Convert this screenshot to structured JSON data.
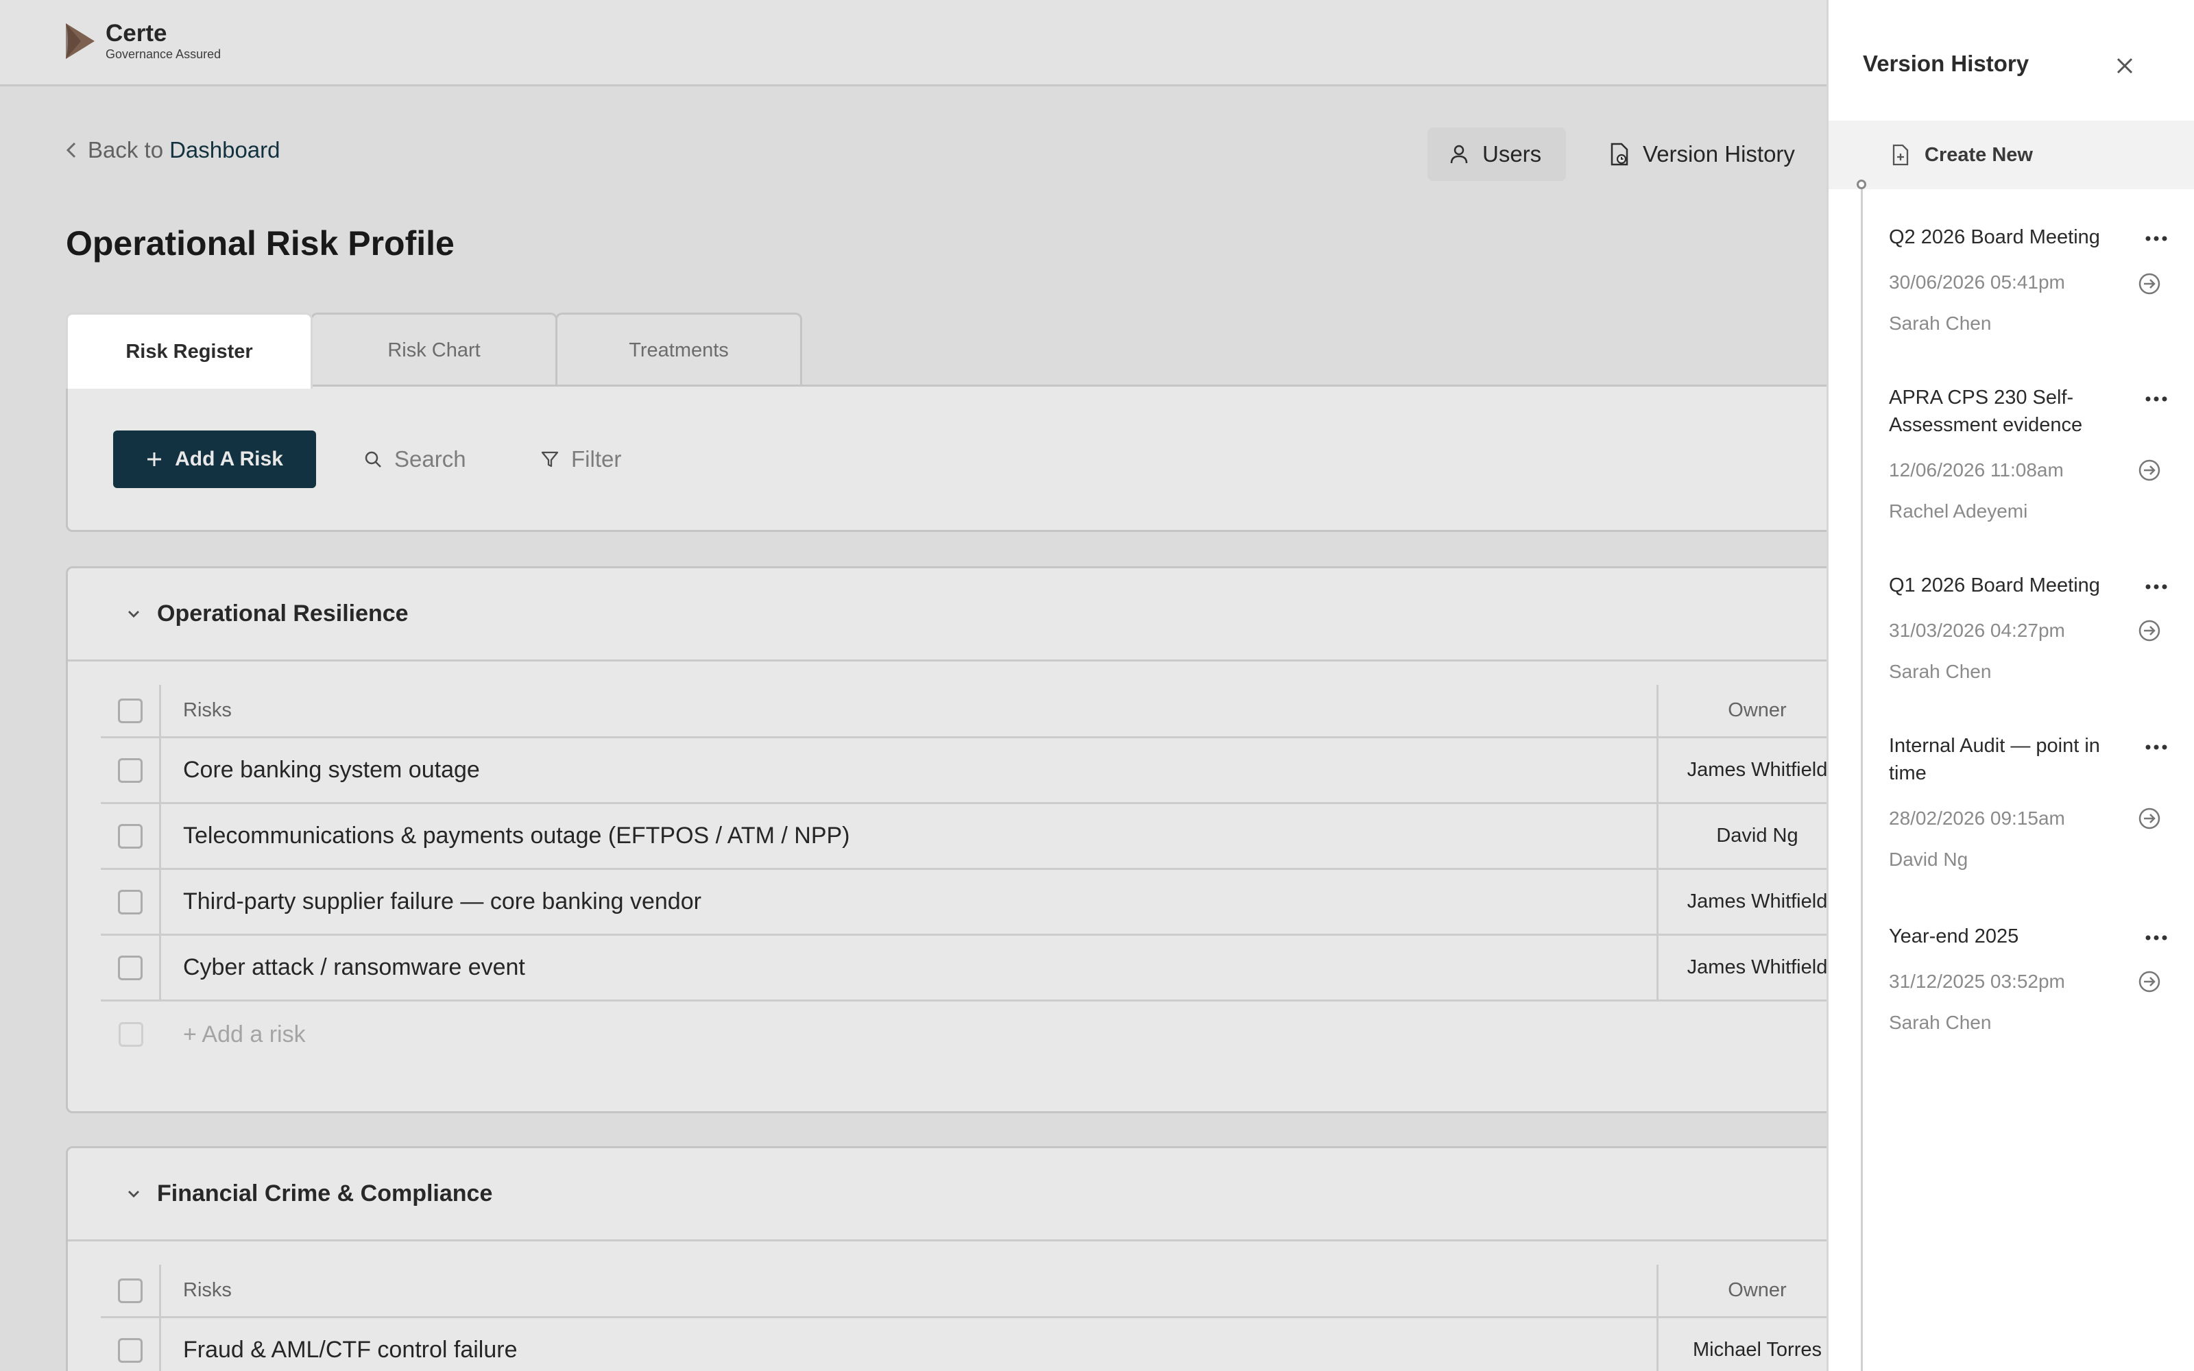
{
  "app": {
    "logo_name": "Certe",
    "logo_tagline": "Governance Assured",
    "brand_color": "#153848",
    "logo_color": "#8a6a58"
  },
  "nav": {
    "back_prefix": "Back to",
    "back_link": "Dashboard"
  },
  "header_buttons": {
    "users": "Users",
    "version_history": "Version History"
  },
  "page": {
    "title": "Operational Risk Profile"
  },
  "tabs": [
    {
      "label": "Risk Register",
      "active": true
    },
    {
      "label": "Risk Chart",
      "active": false
    },
    {
      "label": "Treatments",
      "active": false
    }
  ],
  "toolbar": {
    "add_risk": "Add A Risk",
    "search": "Search",
    "filter": "Filter"
  },
  "sections": [
    {
      "title": "Operational Resilience",
      "columns": {
        "risks": "Risks",
        "owner": "Owner"
      },
      "rows": [
        {
          "risk": "Core banking system outage",
          "owner": "James Whitfield"
        },
        {
          "risk": "Telecommunications & payments outage (EFTPOS / ATM / NPP)",
          "owner": "David Ng"
        },
        {
          "risk": "Third-party supplier failure — core banking vendor",
          "owner": "James Whitfield"
        },
        {
          "risk": "Cyber attack / ransomware event",
          "owner": "James Whitfield"
        }
      ],
      "add_row": "+ Add a risk"
    },
    {
      "title": "Financial Crime & Compliance",
      "columns": {
        "risks": "Risks",
        "owner": "Owner"
      },
      "rows": [
        {
          "risk": "Fraud & AML/CTF control failure",
          "owner": "Michael Torres"
        }
      ]
    }
  ],
  "version_panel": {
    "title": "Version History",
    "create_new": "Create New",
    "versions": [
      {
        "name": "Q2 2026 Board Meeting",
        "date": "30/06/2026 05:41pm",
        "user": "Sarah Chen"
      },
      {
        "name": "APRA CPS 230 Self-Assessment evidence",
        "date": "12/06/2026 11:08am",
        "user": "Rachel Adeyemi"
      },
      {
        "name": "Q1 2026 Board Meeting",
        "date": "31/03/2026 04:27pm",
        "user": "Sarah Chen"
      },
      {
        "name": "Internal Audit — point in time",
        "date": "28/02/2026 09:15am",
        "user": "David Ng"
      },
      {
        "name": "Year-end 2025",
        "date": "31/12/2025 03:52pm",
        "user": "Sarah Chen"
      }
    ]
  }
}
